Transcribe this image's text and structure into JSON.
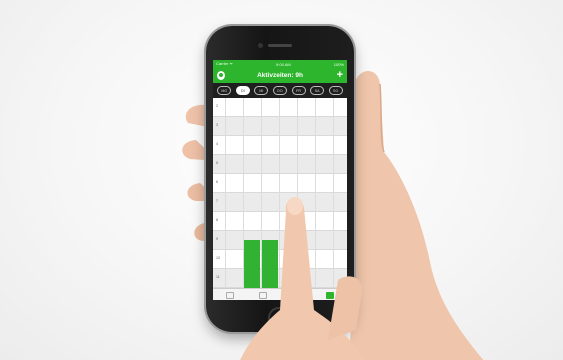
{
  "status_bar": {
    "carrier": "Carrier ᯤ",
    "time": "9:00 AM",
    "battery": "100%"
  },
  "nav": {
    "title": "Aktivzeiten: 9h",
    "add_label": "+"
  },
  "days": [
    {
      "label": "MO",
      "active": false
    },
    {
      "label": "DI",
      "active": true
    },
    {
      "label": "MI",
      "active": false
    },
    {
      "label": "DO",
      "active": false
    },
    {
      "label": "FR",
      "active": false
    },
    {
      "label": "SA",
      "active": false
    },
    {
      "label": "SO",
      "active": false
    }
  ],
  "hours": [
    "2",
    "3",
    "4",
    "5",
    "6",
    "7",
    "8",
    "9",
    "10",
    "11"
  ],
  "colors": {
    "accent": "#2db52d",
    "block": "#32b232",
    "daybar": "#1f1f1f"
  },
  "tabs": [
    {
      "icon": "clock-icon",
      "active": false
    },
    {
      "icon": "power-icon",
      "active": false
    },
    {
      "icon": "list-icon",
      "active": false
    },
    {
      "icon": "calendar-icon",
      "active": true
    }
  ]
}
